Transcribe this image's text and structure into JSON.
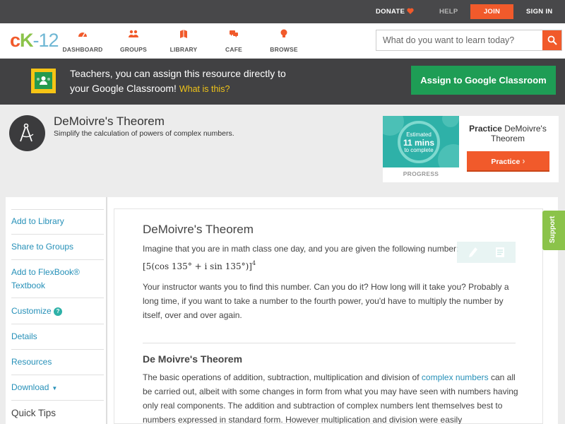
{
  "topbar": {
    "donate": "DONATE",
    "help": "HELP",
    "join": "JOIN",
    "signin": "SIGN IN"
  },
  "nav": {
    "logo_c": "c",
    "logo_k": "K",
    "logo_num": "-12",
    "items": [
      {
        "label": "DASHBOARD",
        "icon": "dashboard-icon"
      },
      {
        "label": "GROUPS",
        "icon": "groups-icon"
      },
      {
        "label": "LIBRARY",
        "icon": "library-icon"
      },
      {
        "label": "CAFE",
        "icon": "cafe-icon"
      },
      {
        "label": "BROWSE",
        "icon": "browse-icon"
      }
    ],
    "search_placeholder": "What do you want to learn today?"
  },
  "banner": {
    "line1": "Teachers, you can assign this resource directly to",
    "line2": "your Google Classroom!",
    "what": "What is this?",
    "button": "Assign to Google Classroom"
  },
  "concept": {
    "title": "DeMoivre's Theorem",
    "subtitle": "Simplify the calculation of powers of complex numbers."
  },
  "practice": {
    "estimated": "Estimated",
    "mins": "11 mins",
    "to_complete": "to complete",
    "progress_label": "PROGRESS",
    "title_bold": "Practice",
    "title_rest": "DeMoivre's Theorem",
    "button": "Practice"
  },
  "sidebar": {
    "items": [
      "Add to Library",
      "Share to Groups",
      "Add to FlexBook®",
      "Textbook",
      "Customize",
      "Details",
      "Resources",
      "Download"
    ],
    "quick_tips": "Quick Tips"
  },
  "content": {
    "heading": "DeMoivre's Theorem",
    "intro": "Imagine that you are in math class one day, and you are given the following number:",
    "math_main": "[5(cos 135° + i sin 135°)]",
    "math_exp": "4",
    "para1": "Your instructor wants you to find this number. Can you do it? How long will it take you? Probably a long time, if you want to take a number to the fourth power, you'd have to multiply the number by itself, over and over again.",
    "subheading": "De Moivre's Theorem",
    "para2_a": "The basic operations of addition, subtraction, multiplication and division of",
    "para2_link": "complex numbers",
    "para2_b": "can all be carried out, albeit with some changes in form from what you may have seen with numbers having only real components. The addition and subtraction of complex numbers lent themselves best to numbers expressed in standard form. However multiplication and division were easily"
  },
  "support": "Support",
  "colors": {
    "accent_orange": "#f15a2b",
    "google_green": "#1e9d55",
    "link_blue": "#2690b8",
    "support_green": "#8bc34a"
  }
}
